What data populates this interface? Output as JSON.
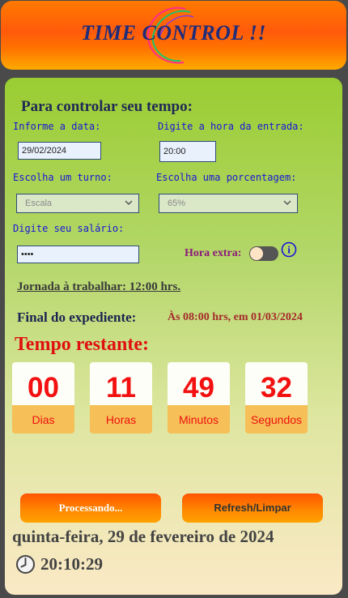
{
  "header": {
    "title": "TIME CONTROL !!"
  },
  "form": {
    "section_title": "Para controlar seu tempo:",
    "date_label": "Informe a data:",
    "date_value": "29/02/2024",
    "entry_label": "Digite a hora da entrada:",
    "entry_value": "20:00",
    "shift_label": "Escolha um turno:",
    "shift_value": "Escala",
    "percent_label": "Escolha uma porcentagem:",
    "percent_value": "65%",
    "salary_label": "Digite seu salário:",
    "salary_value": "••••",
    "overtime_label": "Hora extra:",
    "info_icon": "i"
  },
  "summary": {
    "jornada": "Jornada à trabalhar: 12:00 hrs.",
    "final_label": "Final do expediente:",
    "final_value": "Às 08:00 hrs, em 01/03/2024",
    "remaining_title": "Tempo restante:"
  },
  "countdown": [
    {
      "value": "00",
      "label": "Dias"
    },
    {
      "value": "11",
      "label": "Horas"
    },
    {
      "value": "49",
      "label": "Minutos"
    },
    {
      "value": "32",
      "label": "Segundos"
    }
  ],
  "buttons": {
    "process": "Processando...",
    "refresh": "Refresh/Limpar"
  },
  "footer": {
    "date": "quinta-feira, 29 de fevereiro de 2024",
    "time": "20:10:29"
  },
  "colors": {
    "accent": "#ff6a00",
    "countdown_number": "#f21010",
    "label_blue": "#1616d8"
  }
}
